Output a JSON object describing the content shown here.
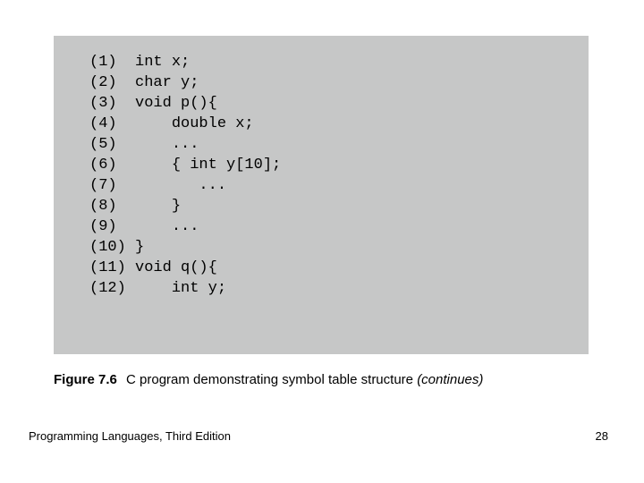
{
  "code": {
    "lines": [
      "(1)  int x;",
      "(2)  char y;",
      "",
      "(3)  void p(){",
      "(4)      double x;",
      "(5)      ...",
      "(6)      { int y[10];",
      "(7)         ...",
      "(8)      }",
      "(9)      ...",
      "(10) }",
      "",
      "(11) void q(){",
      "(12)     int y;"
    ]
  },
  "caption": {
    "label": "Figure 7.6",
    "text": "C program demonstrating symbol table structure",
    "suffix": "(continues)"
  },
  "footer": {
    "left": "Programming Languages, Third Edition",
    "right": "28"
  }
}
